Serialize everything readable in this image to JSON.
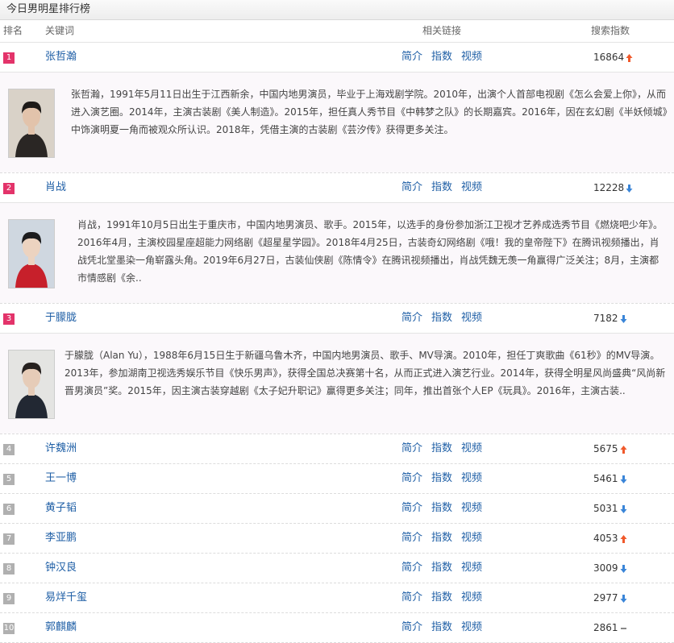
{
  "title": "今日男明星排行榜",
  "header": {
    "rank": "排名",
    "keyword": "关键词",
    "links": "相关链接",
    "index": "搜索指数"
  },
  "link_labels": {
    "intro": "简介",
    "index": "指数",
    "video": "视频"
  },
  "colors": {
    "up": "#f0592b",
    "down": "#3a85d8",
    "flat": "#888888",
    "link": "#1f5fa6",
    "top_rank": "#e3336a"
  },
  "rows": [
    {
      "rank": "1",
      "name": "张哲瀚",
      "index": "16864",
      "trend": "up",
      "desc": "张哲瀚，1991年5月11日出生于江西新余，中国内地男演员，毕业于上海戏剧学院。2010年，出演个人首部电视剧《怎么会爱上你》，从而进入演艺圈。2014年，主演古装剧《美人制造》。2015年，担任真人秀节目《中韩梦之队》的长期嘉宾。2016年，因在玄幻剧《半妖倾城》中饰演明夏一角而被观众所认识。2018年，凭借主演的古装剧《芸汐传》获得更多关注。"
    },
    {
      "rank": "2",
      "name": "肖战",
      "index": "12228",
      "trend": "down",
      "desc": "肖战，1991年10月5日出生于重庆市，中国内地男演员、歌手。2015年，以选手的身份参加浙江卫视才艺养成选秀节目《燃烧吧少年》。2016年4月，主演校园星座超能力网络剧《超星星学园》。2018年4月25日，古装奇幻网络剧《哦！我的皇帝陛下》在腾讯视频播出，肖战凭北堂墨染一角崭露头角。2019年6月27日，古装仙侠剧《陈情令》在腾讯视频播出，肖战凭魏无羡一角赢得广泛关注；8月，主演都市情感剧《余.."
    },
    {
      "rank": "3",
      "name": "于朦胧",
      "index": "7182",
      "trend": "down",
      "desc": "于朦胧（Alan Yu），1988年6月15日生于新疆乌鲁木齐，中国内地男演员、歌手、MV导演。2010年，担任丁爽歌曲《61秒》的MV导演。2013年，参加湖南卫视选秀娱乐节目《快乐男声》，获得全国总决赛第十名，从而正式进入演艺行业。2014年，获得全明星风尚盛典“风尚新晋男演员”奖。2015年，因主演古装穿越剧《太子妃升职记》赢得更多关注；同年，推出首张个人EP《玩具》。2016年，主演古装.."
    },
    {
      "rank": "4",
      "name": "许魏洲",
      "index": "5675",
      "trend": "up"
    },
    {
      "rank": "5",
      "name": "王一博",
      "index": "5461",
      "trend": "down"
    },
    {
      "rank": "6",
      "name": "黄子韬",
      "index": "5031",
      "trend": "down"
    },
    {
      "rank": "7",
      "name": "李亚鹏",
      "index": "4053",
      "trend": "up"
    },
    {
      "rank": "8",
      "name": "钟汉良",
      "index": "3009",
      "trend": "down"
    },
    {
      "rank": "9",
      "name": "易烊千玺",
      "index": "2977",
      "trend": "down"
    },
    {
      "rank": "10",
      "name": "郭麒麟",
      "index": "2861",
      "trend": "flat"
    }
  ]
}
